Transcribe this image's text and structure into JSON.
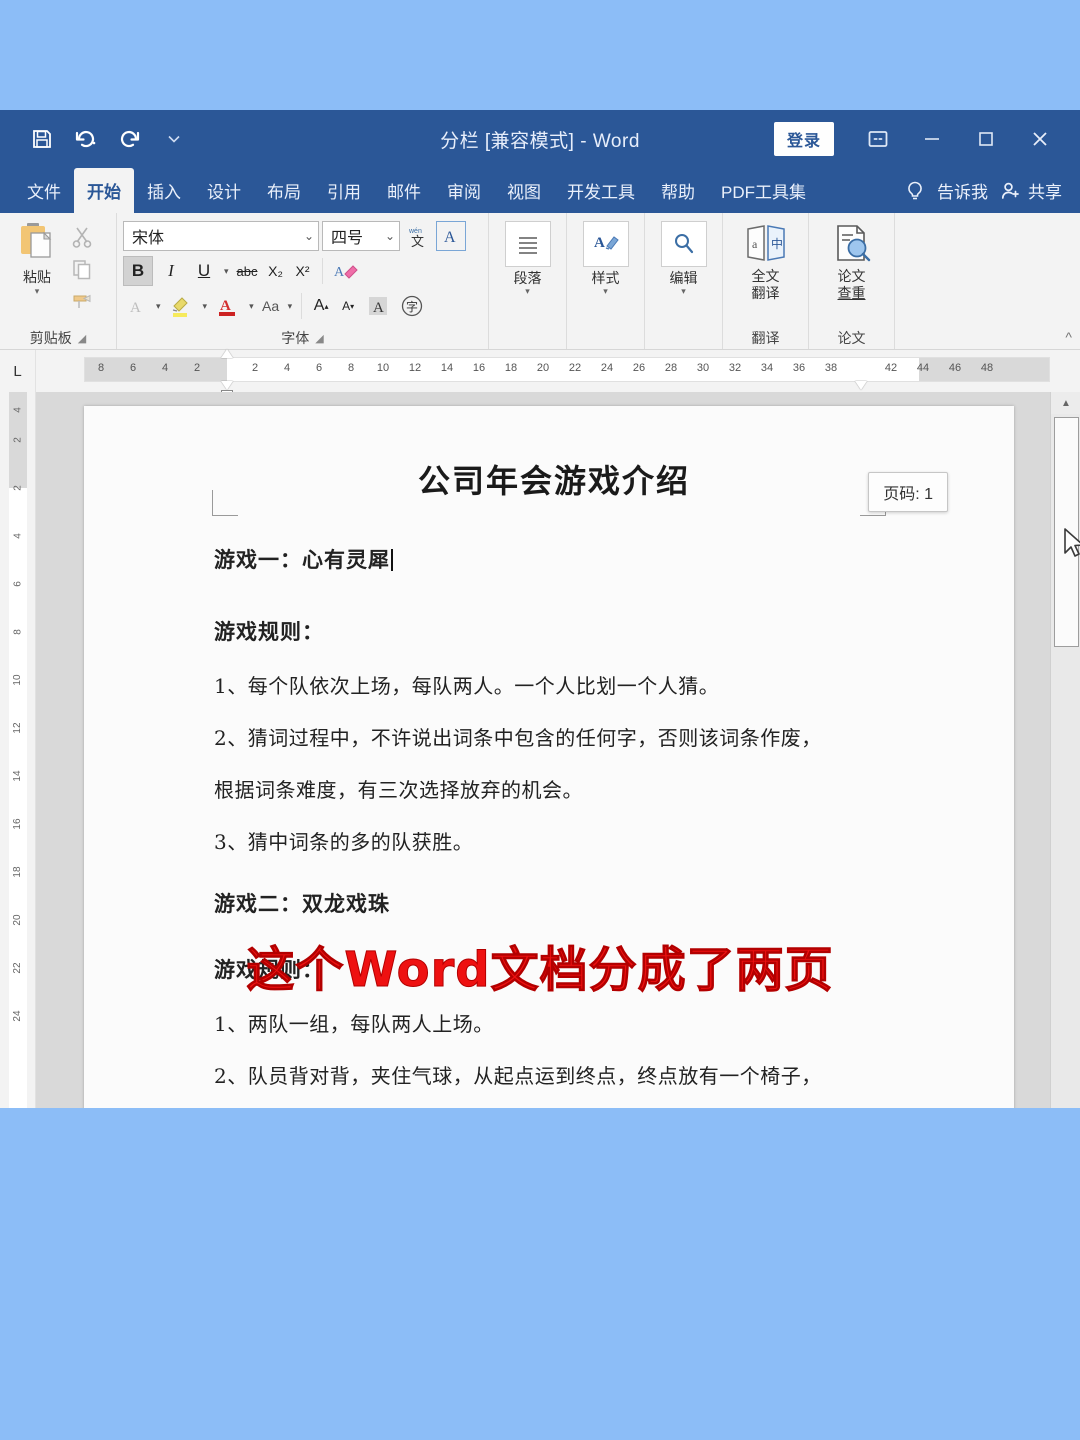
{
  "window": {
    "title": "分栏 [兼容模式] - Word",
    "signin_label": "登录",
    "quick_access": [
      {
        "name": "save-icon",
        "label": "保存"
      },
      {
        "name": "undo-icon",
        "label": "撤消"
      },
      {
        "name": "redo-icon",
        "label": "恢复"
      },
      {
        "name": "customize-qat-icon",
        "label": "自定义快速访问工具栏"
      }
    ],
    "caption_buttons": [
      {
        "name": "ribbon-display-options-icon",
        "label": "功能区显示选项"
      },
      {
        "name": "minimize-icon",
        "label": "最小化"
      },
      {
        "name": "maximize-icon",
        "label": "最大化"
      },
      {
        "name": "close-icon",
        "label": "关闭"
      }
    ]
  },
  "tabs": [
    {
      "label": "文件",
      "active": false
    },
    {
      "label": "开始",
      "active": true
    },
    {
      "label": "插入",
      "active": false
    },
    {
      "label": "设计",
      "active": false
    },
    {
      "label": "布局",
      "active": false
    },
    {
      "label": "引用",
      "active": false
    },
    {
      "label": "邮件",
      "active": false
    },
    {
      "label": "审阅",
      "active": false
    },
    {
      "label": "视图",
      "active": false
    },
    {
      "label": "开发工具",
      "active": false
    },
    {
      "label": "帮助",
      "active": false
    },
    {
      "label": "PDF工具集",
      "active": false
    }
  ],
  "tab_right": {
    "tellme_label": "告诉我",
    "share_label": "共享"
  },
  "ribbon": {
    "clipboard": {
      "group_label": "剪贴板",
      "paste_label": "粘贴",
      "cut_label": "剪切",
      "copy_label": "复制",
      "format_painter_label": "格式刷"
    },
    "font": {
      "group_label": "字体",
      "font_name": "宋体",
      "font_size": "四号",
      "bold": "B",
      "italic": "I",
      "underline": "U",
      "strikethrough": "abc",
      "subscript": "X₂",
      "superscript": "X²",
      "clear_format_label": "清除所有格式",
      "phonetic_label": "拼音指南",
      "char_border_label": "字符边框",
      "text_highlight_label": "文本突出显示颜色",
      "font_color_label": "字体颜色",
      "change_case": "Aa",
      "grow_font": "A",
      "shrink_font": "A",
      "text_effects_label": "文本效果和版式",
      "enclose_char_label": "带圈字符",
      "enclose_char_glyph": "字"
    },
    "paragraph": {
      "label": "段落"
    },
    "styles": {
      "label": "样式"
    },
    "editing": {
      "label": "编辑"
    },
    "translate": {
      "group_label": "翻译",
      "button_label_line1": "全文",
      "button_label_line2": "翻译"
    },
    "thesis": {
      "group_label": "论文",
      "button_label_line1": "论文",
      "button_label_line2": "查重"
    },
    "collapse_label": "折叠功能区"
  },
  "ruler": {
    "tab_stop_marker": "L",
    "horizontal_ticks": [
      "8",
      "6",
      "4",
      "2",
      "2",
      "4",
      "6",
      "8",
      "10",
      "12",
      "14",
      "16",
      "18",
      "20",
      "22",
      "24",
      "26",
      "28",
      "30",
      "32",
      "34",
      "36",
      "38",
      "42",
      "44",
      "46",
      "48"
    ],
    "vertical_ticks": [
      "4",
      "2",
      "2",
      "4",
      "6",
      "8",
      "10",
      "12",
      "14",
      "16",
      "18",
      "20",
      "22",
      "24"
    ]
  },
  "document": {
    "title": "公司年会游戏介绍",
    "blocks": [
      {
        "type": "heading",
        "text": "游戏一：心有灵犀",
        "caret": true
      },
      {
        "type": "heading",
        "text": "游戏规则："
      },
      {
        "type": "para",
        "text": "1、每个队依次上场，每队两人。一个人比划一个人猜。"
      },
      {
        "type": "para",
        "text": "2、猜词过程中，不许说出词条中包含的任何字，否则该词条作废，"
      },
      {
        "type": "para",
        "text": "根据词条难度，有三次选择放弃的机会。"
      },
      {
        "type": "para",
        "text": "3、猜中词条的多的队获胜。"
      },
      {
        "type": "heading",
        "text": "游戏二：双龙戏珠"
      },
      {
        "type": "heading",
        "text": "游戏规则："
      },
      {
        "type": "para",
        "text": "1、两队一组，每队两人上场。"
      },
      {
        "type": "para",
        "text": "2、队员背对背，夹住气球，从起点运到终点，终点放有一个椅子，"
      }
    ]
  },
  "tooltip": {
    "page_number": "页码: 1"
  },
  "overlay": {
    "caption": "这个Word文档分成了两页",
    "color": "#ee1111"
  },
  "colors": {
    "backdrop": "#8cbdf7",
    "word_blue": "#2b5797",
    "ribbon_bg": "#f3f3f3",
    "canvas_gray": "#d9d9d9",
    "page_white": "#fbfbfb"
  }
}
